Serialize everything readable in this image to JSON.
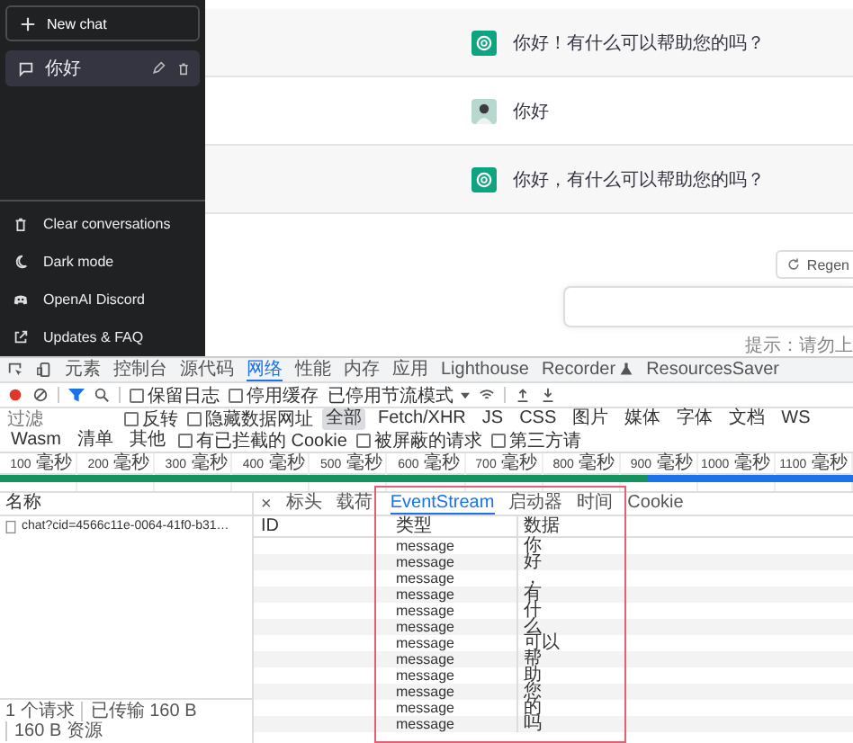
{
  "sidebar": {
    "new_chat": "New chat",
    "conversations": [
      {
        "title": "你好",
        "selected": true
      }
    ],
    "menu": [
      {
        "kind": "trash",
        "label": "Clear conversations"
      },
      {
        "kind": "moon",
        "label": "Dark mode"
      },
      {
        "kind": "discord",
        "label": "OpenAI Discord"
      },
      {
        "kind": "external",
        "label": "Updates & FAQ"
      }
    ]
  },
  "messages": [
    {
      "kind": "assistant",
      "text": "你好！有什么可以帮助您的吗？"
    },
    {
      "kind": "user",
      "text": "你好"
    },
    {
      "kind": "assistant",
      "text": "你好，有什么可以帮助您的吗？"
    }
  ],
  "regenerate_button": "Regen",
  "hint": "提示：请勿上",
  "devtools": {
    "tabs": [
      {
        "label": "元素",
        "selected": false,
        "kind": "text"
      },
      {
        "label": "控制台",
        "selected": false,
        "kind": "text"
      },
      {
        "label": "源代码",
        "selected": false,
        "kind": "text"
      },
      {
        "label": "网络",
        "selected": true,
        "kind": "text"
      },
      {
        "label": "性能",
        "selected": false,
        "kind": "text"
      },
      {
        "label": "内存",
        "selected": false,
        "kind": "text"
      },
      {
        "label": "应用",
        "selected": false,
        "kind": "text"
      },
      {
        "label": "Lighthouse",
        "selected": false,
        "kind": "text"
      },
      {
        "label": "Recorder",
        "selected": false,
        "kind": "flask"
      },
      {
        "label": "ResourcesSaver",
        "selected": false,
        "kind": "text"
      }
    ],
    "toolbar": {
      "recording": true,
      "filter_active": true,
      "checkboxes": [
        {
          "label": "保留日志",
          "checked": false
        },
        {
          "label": "停用缓存",
          "checked": false
        }
      ],
      "throttling": "已停用节流模式"
    },
    "filter": {
      "placeholder": "过滤",
      "options": [
        {
          "label": "反转",
          "checked": false
        },
        {
          "label": "隐藏数据网址",
          "checked": false
        }
      ],
      "types": [
        {
          "label": "全部",
          "selected": true
        },
        {
          "label": "Fetch/XHR",
          "selected": false
        },
        {
          "label": "JS",
          "selected": false
        },
        {
          "label": "CSS",
          "selected": false
        },
        {
          "label": "图片",
          "selected": false
        },
        {
          "label": "媒体",
          "selected": false
        },
        {
          "label": "字体",
          "selected": false
        },
        {
          "label": "文档",
          "selected": false
        },
        {
          "label": "WS",
          "selected": false
        },
        {
          "label": "Wasm",
          "selected": false
        },
        {
          "label": "清单",
          "selected": false
        },
        {
          "label": "其他",
          "selected": false
        }
      ],
      "extra": [
        {
          "label": "有已拦截的 Cookie",
          "checked": false
        },
        {
          "label": "被屏蔽的请求",
          "checked": false
        },
        {
          "label": "第三方请",
          "checked": false
        }
      ]
    },
    "timeline_ticks": [
      "100 毫秒",
      "200 毫秒",
      "300 毫秒",
      "400 毫秒",
      "500 毫秒",
      "600 毫秒",
      "700 毫秒",
      "800 毫秒",
      "900 毫秒",
      "1000 毫秒",
      "1100 毫秒"
    ],
    "requests": {
      "header": "名称",
      "rows": [
        {
          "name": "chat?cid=4566c11e-0064-41f0-b31…",
          "selected": false
        }
      ]
    },
    "status": [
      "1 个请求",
      "已传输 160 B",
      "160 B 资源"
    ],
    "detail_close": "×",
    "detail_tabs": [
      {
        "label": "标头",
        "selected": false
      },
      {
        "label": "载荷",
        "selected": false
      },
      {
        "label": "EventStream",
        "selected": true
      },
      {
        "label": "启动器",
        "selected": false
      },
      {
        "label": "时间",
        "selected": false
      },
      {
        "label": "Cookie",
        "selected": false
      }
    ],
    "event_table": {
      "columns": [
        "ID",
        "类型",
        "数据"
      ],
      "rows": [
        {
          "type": "message",
          "data": "你"
        },
        {
          "type": "message",
          "data": "好"
        },
        {
          "type": "message",
          "data": "，"
        },
        {
          "type": "message",
          "data": "有"
        },
        {
          "type": "message",
          "data": "什"
        },
        {
          "type": "message",
          "data": "么"
        },
        {
          "type": "message",
          "data": "可以"
        },
        {
          "type": "message",
          "data": "帮"
        },
        {
          "type": "message",
          "data": "助"
        },
        {
          "type": "message",
          "data": "您"
        },
        {
          "type": "message",
          "data": "的"
        },
        {
          "type": "message",
          "data": "吗"
        }
      ]
    }
  }
}
